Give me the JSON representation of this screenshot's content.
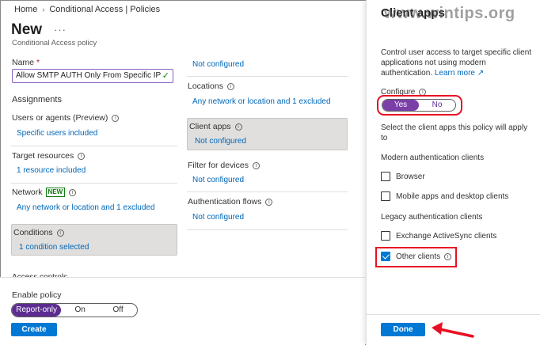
{
  "breadcrumb": {
    "home": "Home",
    "sep": "›",
    "current": "Conditional Access | Policies"
  },
  "header": {
    "title": "New",
    "more": "···",
    "subtitle": "Conditional Access policy"
  },
  "name": {
    "label": "Name",
    "required": "*",
    "value": "Allow SMTP AUTH Only From Specific IP",
    "valid_glyph": "✓"
  },
  "assignments": {
    "heading": "Assignments",
    "users_label": "Users or agents (Preview)",
    "users_value": "Specific users included",
    "target_label": "Target resources",
    "target_value": "1 resource included",
    "network_label": "Network",
    "network_badge": "NEW",
    "network_value": "Any network or location and 1 excluded",
    "conditions_label": "Conditions",
    "conditions_value": "1 condition selected",
    "access_controls": "Access controls"
  },
  "conditions_list": {
    "top_value": "Not configured",
    "locations_label": "Locations",
    "locations_value": "Any network or location and 1 excluded",
    "client_apps_label": "Client apps",
    "client_apps_value": "Not configured",
    "filter_label": "Filter for devices",
    "filter_value": "Not configured",
    "auth_flows_label": "Authentication flows",
    "auth_flows_value": "Not configured"
  },
  "footer": {
    "enable_label": "Enable policy",
    "options": [
      "Report-only",
      "On",
      "Off"
    ],
    "selected": "Report-only",
    "create_label": "Create"
  },
  "panel": {
    "title": "Client apps",
    "watermark": "www.wintips.org",
    "description": "Control user access to target specific client applications not using modern authentication.",
    "learn_more": "Learn more ↗",
    "configure_label": "Configure",
    "toggle_options": [
      "Yes",
      "No"
    ],
    "toggle_selected": "Yes",
    "select_text": "Select the client apps this policy will apply to",
    "modern_heading": "Modern authentication clients",
    "browser": "Browser",
    "mobile": "Mobile apps and desktop clients",
    "legacy_heading": "Legacy authentication clients",
    "exchange": "Exchange ActiveSync clients",
    "other": "Other clients",
    "done_label": "Done"
  },
  "colors": {
    "accent": "#0078d4",
    "toggle": "#7b3fa8",
    "annotation": "#e81123"
  }
}
